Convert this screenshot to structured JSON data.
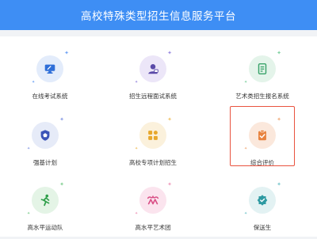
{
  "header": {
    "title": "高校特殊类型招生信息服务平台"
  },
  "tiles": [
    {
      "label": "在线考试系统",
      "icon": "monitor-icon",
      "tint": "#e3ecfb",
      "fg": "#2f6fd8",
      "accent": "#6fa3f5"
    },
    {
      "label": "招生远程面试系统",
      "icon": "interviewer-icon",
      "tint": "#ece6f8",
      "fg": "#5a4aa8",
      "accent": "#9b8ce0"
    },
    {
      "label": "艺术类招生报名系统",
      "icon": "document-icon",
      "tint": "#e4f4ea",
      "fg": "#3aa36a",
      "accent": "#7fd0a0"
    },
    {
      "label": "强基计划",
      "icon": "shield-icon",
      "tint": "#e6ebf8",
      "fg": "#3c54b8",
      "accent": "#8ea0e6"
    },
    {
      "label": "高校专项计划招生",
      "icon": "grid-icon",
      "tint": "#fbf1dc",
      "fg": "#e7a72c",
      "accent": "#f1c46c"
    },
    {
      "label": "综合评价",
      "icon": "clipboard-check-icon",
      "tint": "#fbe8dc",
      "fg": "#e8833f",
      "accent": "#f1b184"
    },
    {
      "label": "高水平运动队",
      "icon": "runner-icon",
      "tint": "#e4f4e6",
      "fg": "#2f9f4a",
      "accent": "#86d096"
    },
    {
      "label": "高水平艺术团",
      "icon": "dancer-icon",
      "tint": "#fbe4ee",
      "fg": "#d94f86",
      "accent": "#ef9dbd"
    },
    {
      "label": "保送生",
      "icon": "badge-icon",
      "tint": "#e3f2f3",
      "fg": "#2e9aa2",
      "accent": "#7fc9cf"
    }
  ],
  "selected_index": 5,
  "colors": {
    "header_bg": "#3e8ef4",
    "selection_border": "#e9533f"
  }
}
